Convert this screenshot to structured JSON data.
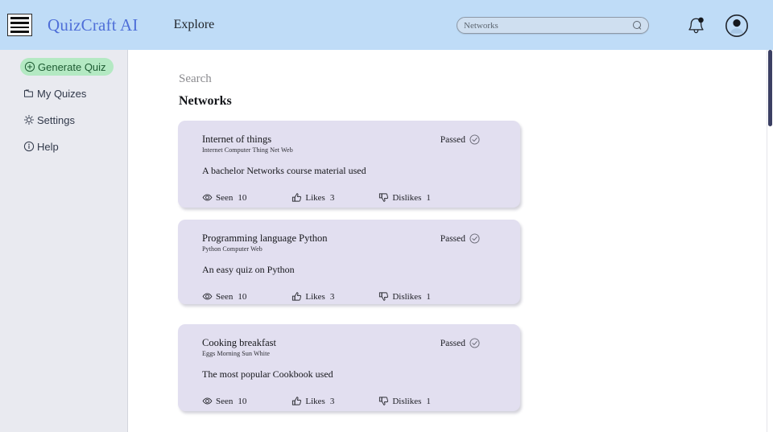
{
  "header": {
    "menu_icon": "hamburger-menu-icon",
    "brand": "QuizCraft AI",
    "explore_label": "Explore",
    "search": {
      "value": "Networks",
      "placeholder": "Networks",
      "icon": "search-icon"
    },
    "notifications_icon": "bell-icon",
    "has_notification_badge": true,
    "account_icon": "user-avatar-icon",
    "background_color": "#bfdcf7"
  },
  "sidebar": {
    "background_color": "#e9eaf0",
    "items": [
      {
        "label": "Generate Quiz",
        "icon": "plus-circle-icon",
        "active": true
      },
      {
        "label": "My Quizes",
        "icon": "folder-icon",
        "active": false
      },
      {
        "label": "Settings",
        "icon": "gear-icon",
        "active": false
      },
      {
        "label": "Help",
        "icon": "info-circle-icon",
        "active": false
      }
    ],
    "active_color": "#b4e9c3"
  },
  "main": {
    "kicker": "Search",
    "title": "Networks",
    "card_color": "#e2dff0",
    "cards": [
      {
        "title": "Internet of things",
        "tags": "Internet Computer Thing Net Web",
        "description": "A bachelor Networks course material used",
        "status": "Passed",
        "status_icon": "check-circle-icon",
        "stats": {
          "seen_label": "Seen",
          "seen_value": "10",
          "seen_icon": "eye-icon",
          "likes_label": "Likes",
          "likes_value": "3",
          "likes_icon": "thumbs-up-icon",
          "dislikes_label": "Dislikes",
          "dislikes_value": "1",
          "dislikes_icon": "thumbs-down-icon"
        }
      },
      {
        "title": "Programming language Python",
        "tags": "Python Computer Web",
        "description": "An easy quiz on Python",
        "status": "Passed",
        "status_icon": "check-circle-icon",
        "stats": {
          "seen_label": "Seen",
          "seen_value": "10",
          "seen_icon": "eye-icon",
          "likes_label": "Likes",
          "likes_value": "3",
          "likes_icon": "thumbs-up-icon",
          "dislikes_label": "Dislikes",
          "dislikes_value": "1",
          "dislikes_icon": "thumbs-down-icon"
        }
      },
      {
        "title": "Cooking breakfast",
        "tags": "Eggs Morning Sun White",
        "description": "The most popular Cookbook used",
        "status": "Passed",
        "status_icon": "check-circle-icon",
        "stats": {
          "seen_label": "Seen",
          "seen_value": "10",
          "seen_icon": "eye-icon",
          "likes_label": "Likes",
          "likes_value": "3",
          "likes_icon": "thumbs-up-icon",
          "dislikes_label": "Dislikes",
          "dislikes_value": "1",
          "dislikes_icon": "thumbs-down-icon"
        }
      }
    ]
  },
  "scrollbar": {
    "thumb_color": "#3b3f63"
  }
}
